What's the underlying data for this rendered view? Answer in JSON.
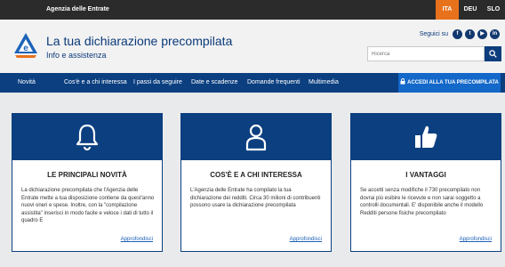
{
  "topbar": {
    "agency": "Agenzia delle Entrate",
    "languages": [
      {
        "label": "ITA",
        "active": true
      },
      {
        "label": "DEU",
        "active": false
      },
      {
        "label": "SLO",
        "active": false
      }
    ]
  },
  "header": {
    "title": "La tua dichiarazione precompilata",
    "subtitle": "Info e assistenza",
    "social_label": "Seguici su",
    "social_icons": [
      {
        "name": "facebook-icon",
        "glyph": "f"
      },
      {
        "name": "twitter-icon",
        "glyph": "t"
      },
      {
        "name": "youtube-icon",
        "glyph": "▶"
      },
      {
        "name": "linkedin-icon",
        "glyph": "in"
      }
    ],
    "search_placeholder": "Ricerca"
  },
  "nav": {
    "items": [
      "Novità",
      "Cos'è e a chi interessa",
      "I passi da seguire",
      "Date e scadenze",
      "Domande frequenti",
      "Multimedia"
    ],
    "access_label": "ACCEDI ALLA TUA PRECOMPILATA"
  },
  "cards": [
    {
      "icon": "bell-icon",
      "title": "LE PRINCIPALI NOVITÀ",
      "text": "La dichiarazione precompilata che l'Agenzia delle Entrate mette a tua disposizione contiene da quest'anno nuovi oneri e spese. Inoltre, con la \"compilazione assistita\" inserisci in modo facile e veloce i dati di tutto il quadro E",
      "link": "Approfondisci"
    },
    {
      "icon": "person-icon",
      "title": "COS'È E A CHI INTERESSA",
      "text": "L'Agenzia delle Entrate ha compilato la tua dichiarazione dei redditi. Circa 30 milioni di contribuenti possono usare la dichiarazione precompilata",
      "link": "Approfondisci"
    },
    {
      "icon": "thumbs-up-icon",
      "title": "I VANTAGGI",
      "text": "Se accetti senza modifiche il 730 precompilato non dovrai più esibire le ricevute e non sarai soggetto a controlli documentali. E' disponibile anche il modello Redditi persone fisiche precompilato",
      "link": "Approfondisci"
    }
  ],
  "colors": {
    "topbar": "#2b2b2b",
    "nav": "#0b3f80",
    "accent_orange": "#e8711c",
    "access_button": "#1468c9",
    "title": "#0b3a78"
  }
}
